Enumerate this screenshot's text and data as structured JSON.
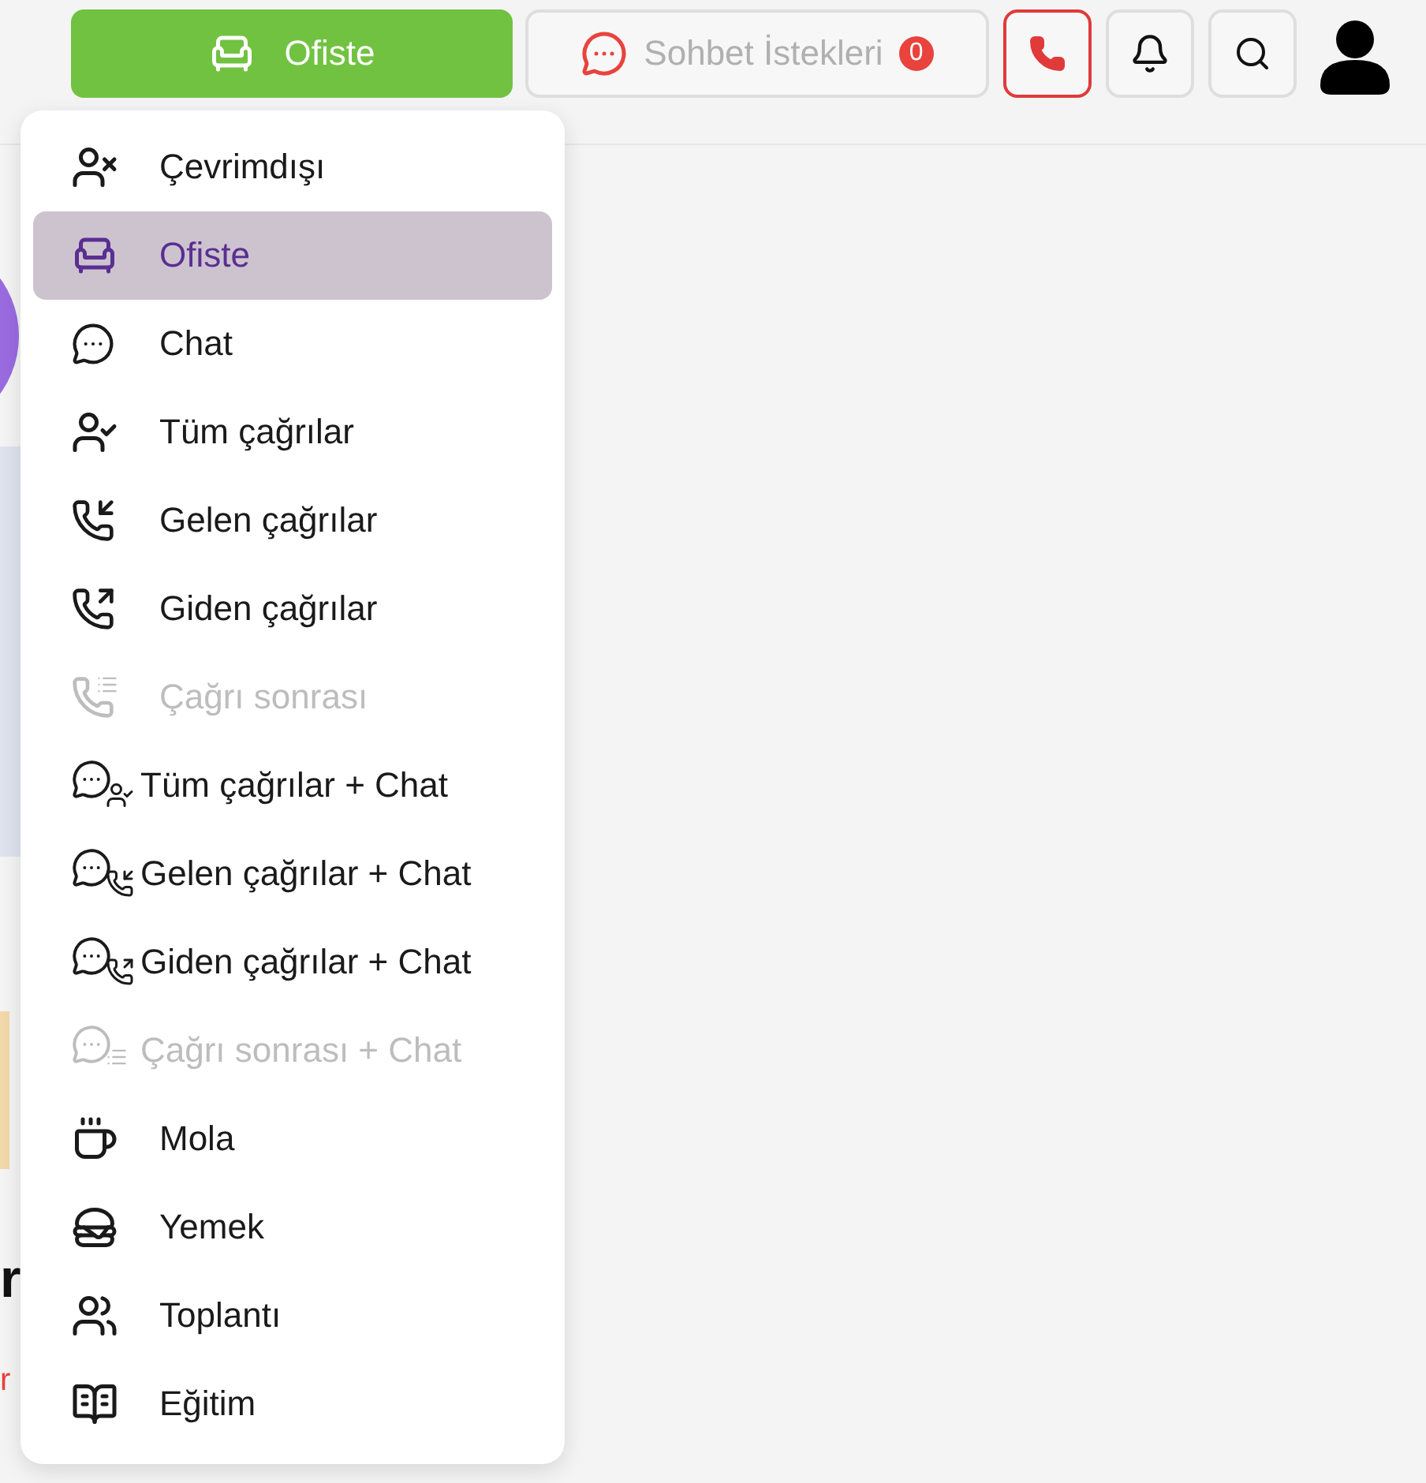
{
  "top_bar": {
    "status_button": {
      "label": "Ofiste"
    },
    "chat_requests_button": {
      "label": "Sohbet İstekleri",
      "count": "0"
    }
  },
  "background_fragments": [
    "r",
    "r"
  ],
  "status_menu": {
    "items": [
      {
        "label": "Çevrimdışı",
        "selected": false,
        "disabled": false
      },
      {
        "label": "Ofiste",
        "selected": true,
        "disabled": false
      },
      {
        "label": "Chat",
        "selected": false,
        "disabled": false
      },
      {
        "label": "Tüm çağrılar",
        "selected": false,
        "disabled": false
      },
      {
        "label": "Gelen çağrılar",
        "selected": false,
        "disabled": false
      },
      {
        "label": "Giden çağrılar",
        "selected": false,
        "disabled": false
      },
      {
        "label": "Çağrı sonrası",
        "selected": false,
        "disabled": true
      },
      {
        "label": "Tüm çağrılar + Chat",
        "selected": false,
        "disabled": false
      },
      {
        "label": "Gelen çağrılar + Chat",
        "selected": false,
        "disabled": false
      },
      {
        "label": "Giden çağrılar + Chat",
        "selected": false,
        "disabled": false
      },
      {
        "label": "Çağrı sonrası + Chat",
        "selected": false,
        "disabled": true
      },
      {
        "label": "Mola",
        "selected": false,
        "disabled": false
      },
      {
        "label": "Yemek",
        "selected": false,
        "disabled": false
      },
      {
        "label": "Toplantı",
        "selected": false,
        "disabled": false
      },
      {
        "label": "Eğitim",
        "selected": false,
        "disabled": false
      }
    ]
  }
}
